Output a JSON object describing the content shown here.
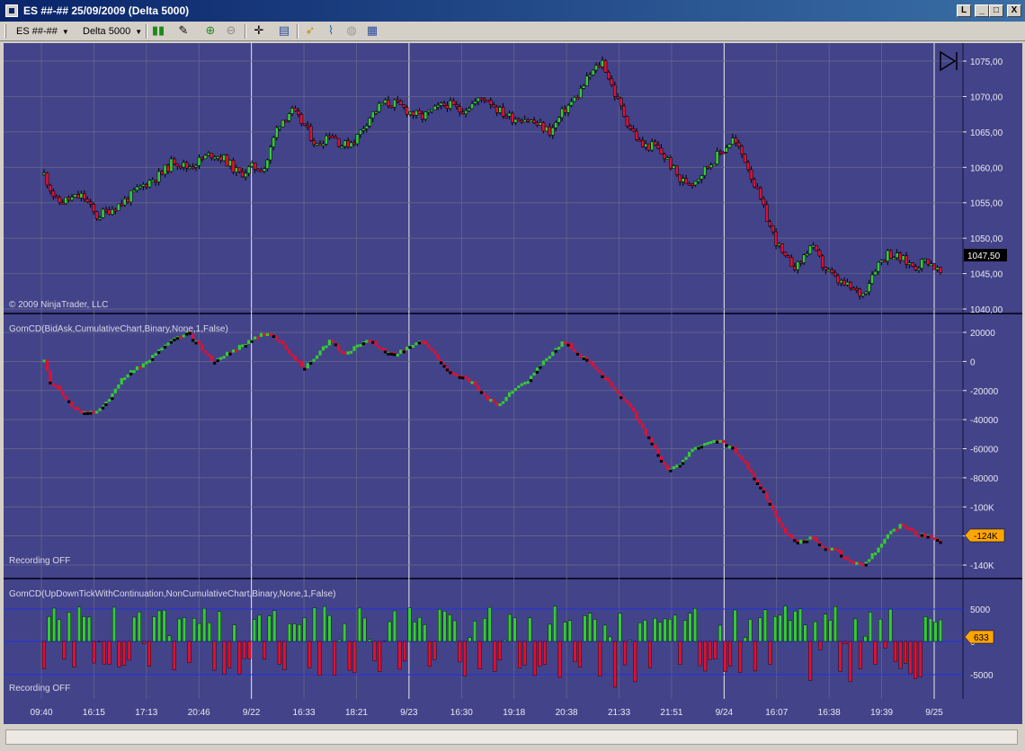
{
  "window": {
    "title": "ES ##-##  25/09/2009 (Delta 5000)",
    "buttons": [
      "L",
      "_",
      "□",
      "X"
    ]
  },
  "toolbar": {
    "instrument": "ES ##-##",
    "period": "Delta 5000",
    "icons": [
      "candlestick-icon",
      "pencil-icon",
      "zoom-in-icon",
      "zoom-out-icon",
      "crosshair-icon",
      "properties-icon",
      "strategy-icon",
      "indicator-icon",
      "clock-icon",
      "data-box-icon"
    ]
  },
  "colors": {
    "background": "#43438a",
    "up": "#33cc33",
    "down": "#e01030",
    "grid": "#6a6a88",
    "session_line": "#e8e8e8"
  },
  "price_panel": {
    "copyright": "© 2009 NinjaTrader, LLC",
    "axis_labels": [
      "1075,00",
      "1070,00",
      "1065,00",
      "1060,00",
      "1055,00",
      "1050,00",
      "1045,00",
      "1040,00"
    ],
    "last_price": "1047,50"
  },
  "cd_panel": {
    "label": "GomCD(BidAsk,CumulativeChart,Binary,None,1,False)",
    "status": "Recording OFF",
    "axis_labels": [
      "20000",
      "0",
      "-20000",
      "-40000",
      "-60000",
      "-80000",
      "-100K",
      "-120K",
      "-140K"
    ],
    "last_value": "-124K"
  },
  "delta_panel": {
    "label": "GomCD(UpDownTickWithContinuation,NonCumulativeChart,Binary,None,1,False)",
    "status": "Recording OFF",
    "axis_labels": [
      "5000",
      "0",
      "-5000"
    ],
    "last_value": "633"
  },
  "time_axis": [
    "09:40",
    "16:15",
    "17:13",
    "20:46",
    "9/22",
    "16:33",
    "18:21",
    "9/23",
    "16:30",
    "19:18",
    "20:38",
    "21:33",
    "21:51",
    "9/24",
    "16:07",
    "16:38",
    "19:39",
    "9/25"
  ],
  "chart_data": [
    {
      "type": "candlestick",
      "title": "",
      "ylim": [
        1040,
        1076
      ],
      "close_path": [
        [
          0,
          1059
        ],
        [
          1,
          1055
        ],
        [
          3,
          1056
        ],
        [
          4,
          1053
        ],
        [
          5,
          1054
        ],
        [
          6,
          1055
        ],
        [
          8,
          1058
        ],
        [
          9,
          1059
        ],
        [
          10,
          1061
        ],
        [
          11,
          1060
        ],
        [
          12,
          1061
        ],
        [
          13,
          1062
        ],
        [
          14,
          1061
        ],
        [
          15,
          1059
        ],
        [
          16,
          1060
        ],
        [
          17,
          1060
        ],
        [
          18,
          1066
        ],
        [
          19,
          1068
        ],
        [
          20,
          1066
        ],
        [
          21,
          1063
        ],
        [
          22,
          1065
        ],
        [
          23,
          1063
        ],
        [
          24,
          1064
        ],
        [
          25,
          1067
        ],
        [
          26,
          1069
        ],
        [
          27,
          1069
        ],
        [
          28,
          1068
        ],
        [
          29,
          1067
        ],
        [
          30,
          1068
        ],
        [
          31,
          1069
        ],
        [
          32,
          1068
        ],
        [
          33,
          1069
        ],
        [
          34,
          1070
        ],
        [
          35,
          1068
        ],
        [
          36,
          1067
        ],
        [
          37,
          1067
        ],
        [
          38,
          1066
        ],
        [
          39,
          1065
        ],
        [
          40,
          1068
        ],
        [
          41,
          1070
        ],
        [
          42,
          1073
        ],
        [
          43,
          1075
        ],
        [
          44,
          1070
        ],
        [
          45,
          1066
        ],
        [
          46,
          1063
        ],
        [
          47,
          1063
        ],
        [
          48,
          1061
        ],
        [
          49,
          1058
        ],
        [
          50,
          1058
        ],
        [
          51,
          1060
        ],
        [
          52,
          1062
        ],
        [
          53,
          1064
        ],
        [
          54,
          1061
        ],
        [
          55,
          1056
        ],
        [
          56,
          1051
        ],
        [
          57,
          1047
        ],
        [
          58,
          1046
        ],
        [
          59,
          1049
        ],
        [
          60,
          1046
        ],
        [
          61,
          1044
        ],
        [
          62,
          1043
        ],
        [
          63,
          1042
        ],
        [
          64,
          1046
        ],
        [
          65,
          1048
        ],
        [
          66,
          1047
        ],
        [
          67,
          1046
        ],
        [
          68,
          1047
        ],
        [
          69,
          1045
        ]
      ]
    },
    {
      "type": "line",
      "title": "",
      "ylim": [
        -145000,
        25000
      ],
      "path": [
        [
          0,
          0
        ],
        [
          0.5,
          -15000
        ],
        [
          1,
          -18000
        ],
        [
          2,
          -30000
        ],
        [
          3,
          -35000
        ],
        [
          4,
          -35000
        ],
        [
          5,
          -25000
        ],
        [
          6,
          -12000
        ],
        [
          7,
          -5000
        ],
        [
          8,
          0
        ],
        [
          9,
          10000
        ],
        [
          10,
          15000
        ],
        [
          11,
          20000
        ],
        [
          12,
          10000
        ],
        [
          13,
          0
        ],
        [
          14,
          5000
        ],
        [
          15,
          10000
        ],
        [
          16,
          15000
        ],
        [
          17,
          20000
        ],
        [
          18,
          15000
        ],
        [
          19,
          5000
        ],
        [
          20,
          -5000
        ],
        [
          21,
          5000
        ],
        [
          22,
          15000
        ],
        [
          23,
          5000
        ],
        [
          24,
          10000
        ],
        [
          25,
          15000
        ],
        [
          26,
          8000
        ],
        [
          27,
          5000
        ],
        [
          28,
          10000
        ],
        [
          29,
          15000
        ],
        [
          30,
          5000
        ],
        [
          31,
          -5000
        ],
        [
          32,
          -10000
        ],
        [
          33,
          -15000
        ],
        [
          34,
          -25000
        ],
        [
          35,
          -30000
        ],
        [
          36,
          -20000
        ],
        [
          37,
          -15000
        ],
        [
          38,
          -5000
        ],
        [
          39,
          5000
        ],
        [
          40,
          15000
        ],
        [
          41,
          5000
        ],
        [
          42,
          0
        ],
        [
          43,
          -10000
        ],
        [
          44,
          -20000
        ],
        [
          45,
          -30000
        ],
        [
          46,
          -45000
        ],
        [
          47,
          -60000
        ],
        [
          48,
          -75000
        ],
        [
          49,
          -70000
        ],
        [
          50,
          -60000
        ],
        [
          51,
          -55000
        ],
        [
          52,
          -55000
        ],
        [
          53,
          -60000
        ],
        [
          54,
          -70000
        ],
        [
          55,
          -85000
        ],
        [
          56,
          -100000
        ],
        [
          57,
          -118000
        ],
        [
          58,
          -125000
        ],
        [
          59,
          -120000
        ],
        [
          60,
          -128000
        ],
        [
          61,
          -130000
        ],
        [
          62,
          -138000
        ],
        [
          63,
          -140000
        ],
        [
          64,
          -130000
        ],
        [
          65,
          -118000
        ],
        [
          66,
          -112000
        ],
        [
          67,
          -118000
        ],
        [
          68,
          -120000
        ],
        [
          69,
          -124000
        ]
      ]
    },
    {
      "type": "bar",
      "title": "",
      "ylim": [
        -8000,
        8000
      ],
      "bar_count": 180,
      "pattern_seed": 7,
      "values_range": [
        -5500,
        5500
      ]
    }
  ]
}
